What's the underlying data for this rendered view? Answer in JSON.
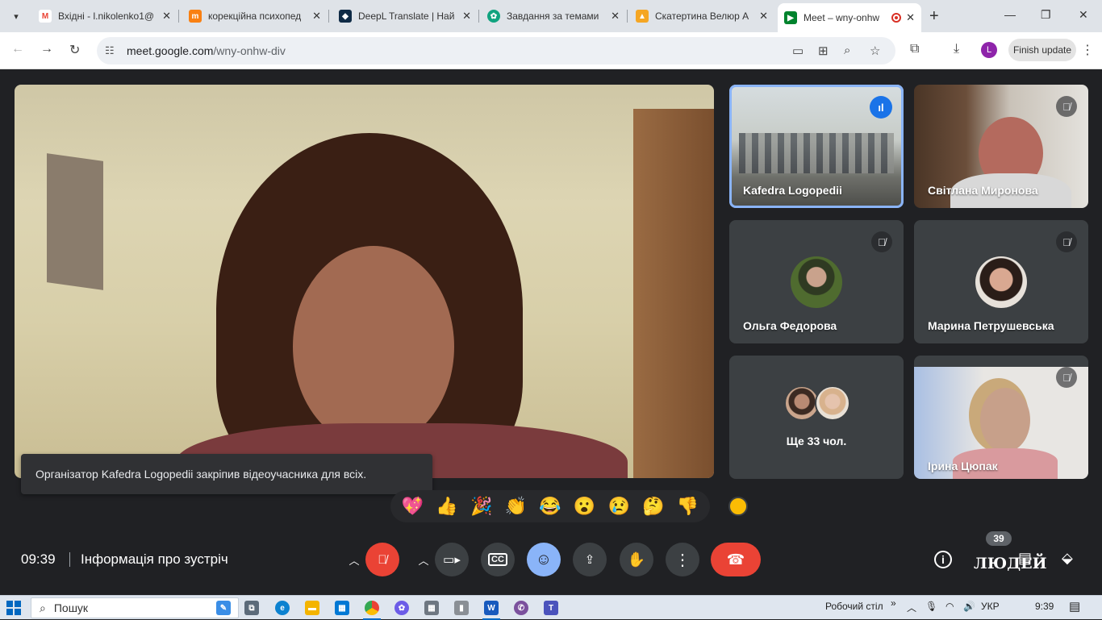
{
  "browser": {
    "tabs": [
      {
        "title": "Вхідні - l.nikolenko1@",
        "favicon": "gmail-icon",
        "color": "#ea4335"
      },
      {
        "title": "корекційна психопед",
        "favicon": "moodle-icon",
        "color": "#f98012"
      },
      {
        "title": "DeepL Translate | Най",
        "favicon": "deepl-icon",
        "color": "#0f2b46"
      },
      {
        "title": "Завдання за темами",
        "favicon": "chatgpt-icon",
        "color": "#10a37f"
      },
      {
        "title": "Скатертина Велюр А",
        "favicon": "shop-icon",
        "color": "#f5a623"
      },
      {
        "title": "Meet – wny-onhw",
        "favicon": "meet-icon",
        "color": "#00832d",
        "active": true
      }
    ],
    "url_host": "meet.google.com",
    "url_path": "/wny-onhw-div",
    "profile_initial": "L",
    "finish_update_label": "Finish update"
  },
  "meet": {
    "pinned_toast": "Організатор Kafedra Logopedii закріпив відеоучасника для всіх.",
    "participants": [
      {
        "name": "Kafedra Logopedii",
        "speaking": true
      },
      {
        "name": "Світлана Миронова",
        "muted": true
      },
      {
        "name": "Ольга Федорова",
        "muted": true
      },
      {
        "name": "Марина Петрушевська",
        "muted": true
      },
      {
        "name": "Ще 33 чол."
      },
      {
        "name": "Ірина Цюпак",
        "muted": true
      }
    ],
    "reactions": [
      "💖",
      "👍",
      "🎉",
      "👏",
      "😂",
      "😮",
      "😢",
      "🤔",
      "👎"
    ],
    "clock": "09:39",
    "meeting_info_label": "Інформація про зустріч",
    "people_count": "39",
    "people_label": "ЛЮДЕЙ"
  },
  "taskbar": {
    "search_placeholder": "Пошук",
    "desktop_label": "Робочий стіл",
    "language": "УКР",
    "time": "9:39"
  }
}
